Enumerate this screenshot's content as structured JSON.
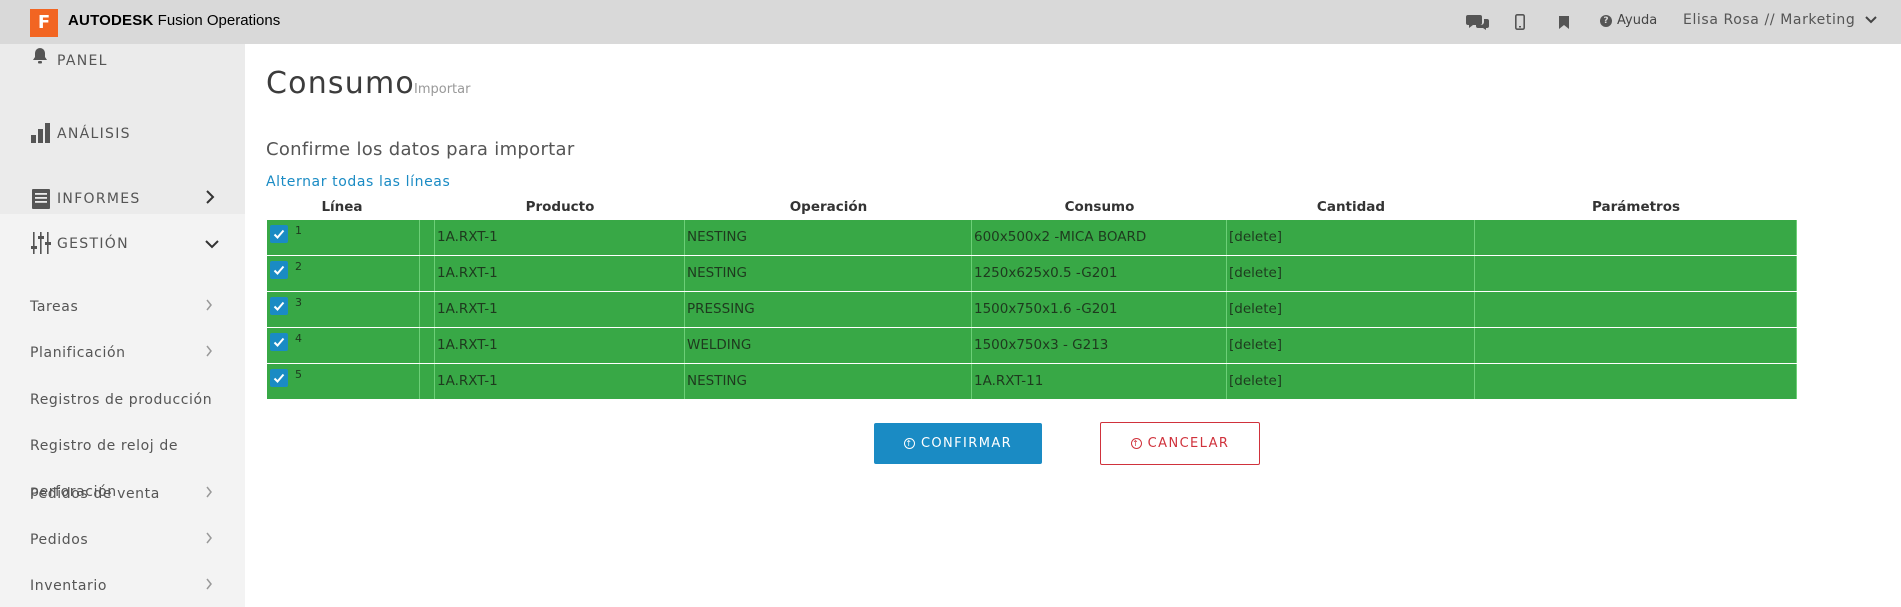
{
  "topbar": {
    "logo_letter": "F",
    "brand_bold": "AUTODESK",
    "brand_light": "Fusion Operations",
    "help_label": "Ayuda",
    "user_label": "Elisa Rosa // Marketing"
  },
  "sidebar": {
    "panel": "PANEL",
    "analisis": "ANÁLISIS",
    "informes": "INFORMES",
    "gestion": "GESTIÓN",
    "sub_items": [
      "Tareas",
      "Planificación",
      "Registros de producción",
      "Registro de reloj de",
      "perforación",
      "Pedidos de venta",
      "Pedidos",
      "Inventario"
    ]
  },
  "page": {
    "title": "Consumo",
    "subtitle": "Importar",
    "heading": "Confirme los datos para importar",
    "toggle_all": "Alternar todas las líneas"
  },
  "table": {
    "headers": {
      "linea": "Línea",
      "producto": "Producto",
      "operacion": "Operación",
      "consumo": "Consumo",
      "cantidad": "Cantidad",
      "parametros": "Parámetros"
    },
    "rows": [
      {
        "linea": "1",
        "producto": "1A.RXT-1",
        "operacion": "NESTING",
        "consumo": "600x500x2 -MICA BOARD",
        "cantidad": "[delete]",
        "parametros": ""
      },
      {
        "linea": "2",
        "producto": "1A.RXT-1",
        "operacion": "NESTING",
        "consumo": "1250x625x0.5 -G201",
        "cantidad": "[delete]",
        "parametros": ""
      },
      {
        "linea": "3",
        "producto": "1A.RXT-1",
        "operacion": "PRESSING",
        "consumo": "1500x750x1.6 -G201",
        "cantidad": "[delete]",
        "parametros": ""
      },
      {
        "linea": "4",
        "producto": "1A.RXT-1",
        "operacion": "WELDING",
        "consumo": "1500x750x3 - G213",
        "cantidad": "[delete]",
        "parametros": ""
      },
      {
        "linea": "5",
        "producto": "1A.RXT-1",
        "operacion": "NESTING",
        "consumo": "1A.RXT-11",
        "cantidad": "[delete]",
        "parametros": ""
      }
    ]
  },
  "actions": {
    "confirm_label": "CONFIRMAR",
    "cancel_label": "CANCELAR"
  },
  "colors": {
    "accent": "#1a8bc4",
    "row_green": "#38a846",
    "cancel_red": "#d0323c",
    "logo_orange": "#f26522"
  }
}
